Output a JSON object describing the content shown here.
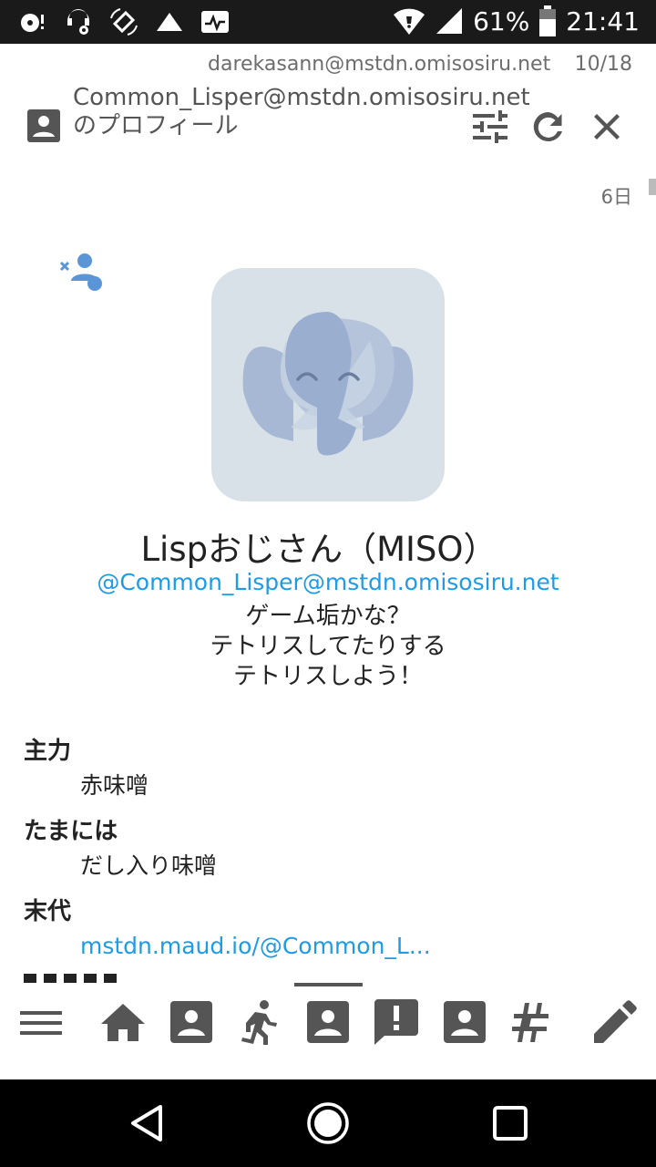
{
  "status_bar": {
    "battery": "61%",
    "time": "21:41",
    "icons": [
      "disc-alert-icon",
      "headset-settings-icon",
      "screen-rotation-icon",
      "signal-triangle-icon",
      "activity-icon",
      "wifi-icon",
      "cell-signal-icon",
      "battery-icon"
    ]
  },
  "account_row": {
    "account": "darekasann@mstdn.omisosiru.net",
    "position": "10/18"
  },
  "column_header": {
    "title": "Common_Lisper@mstdn.omisosiru.net のプロフィール",
    "icons": [
      "account-box-icon",
      "tune-icon",
      "refresh-icon",
      "close-icon"
    ]
  },
  "profile": {
    "age": "6日",
    "display_name": "Lispおじさん（MISO）",
    "acct": "@Common_Lisper@mstdn.omisosiru.net",
    "note": [
      "ゲーム垢かな？",
      "テトリスしてたりする",
      "テトリスしよう！"
    ],
    "fields": [
      {
        "name": "主力",
        "value": "赤味噌",
        "is_link": false
      },
      {
        "name": "たまには",
        "value": "だし入り味噌",
        "is_link": false
      },
      {
        "name": "末代",
        "value": "mstdn.maud.io/@Common_L...",
        "is_link": true
      }
    ]
  },
  "bottom_bar": {
    "items": [
      "menu-icon",
      "home-icon",
      "account-box-icon",
      "running-icon",
      "account-box-icon",
      "alert-comment-icon",
      "account-box-icon",
      "hashtag-icon",
      "pencil-icon"
    ],
    "active_index": 4
  },
  "colors": {
    "link": "#1e9be6",
    "icon": "#555555",
    "avatar_bg": "#d9e1e8"
  }
}
